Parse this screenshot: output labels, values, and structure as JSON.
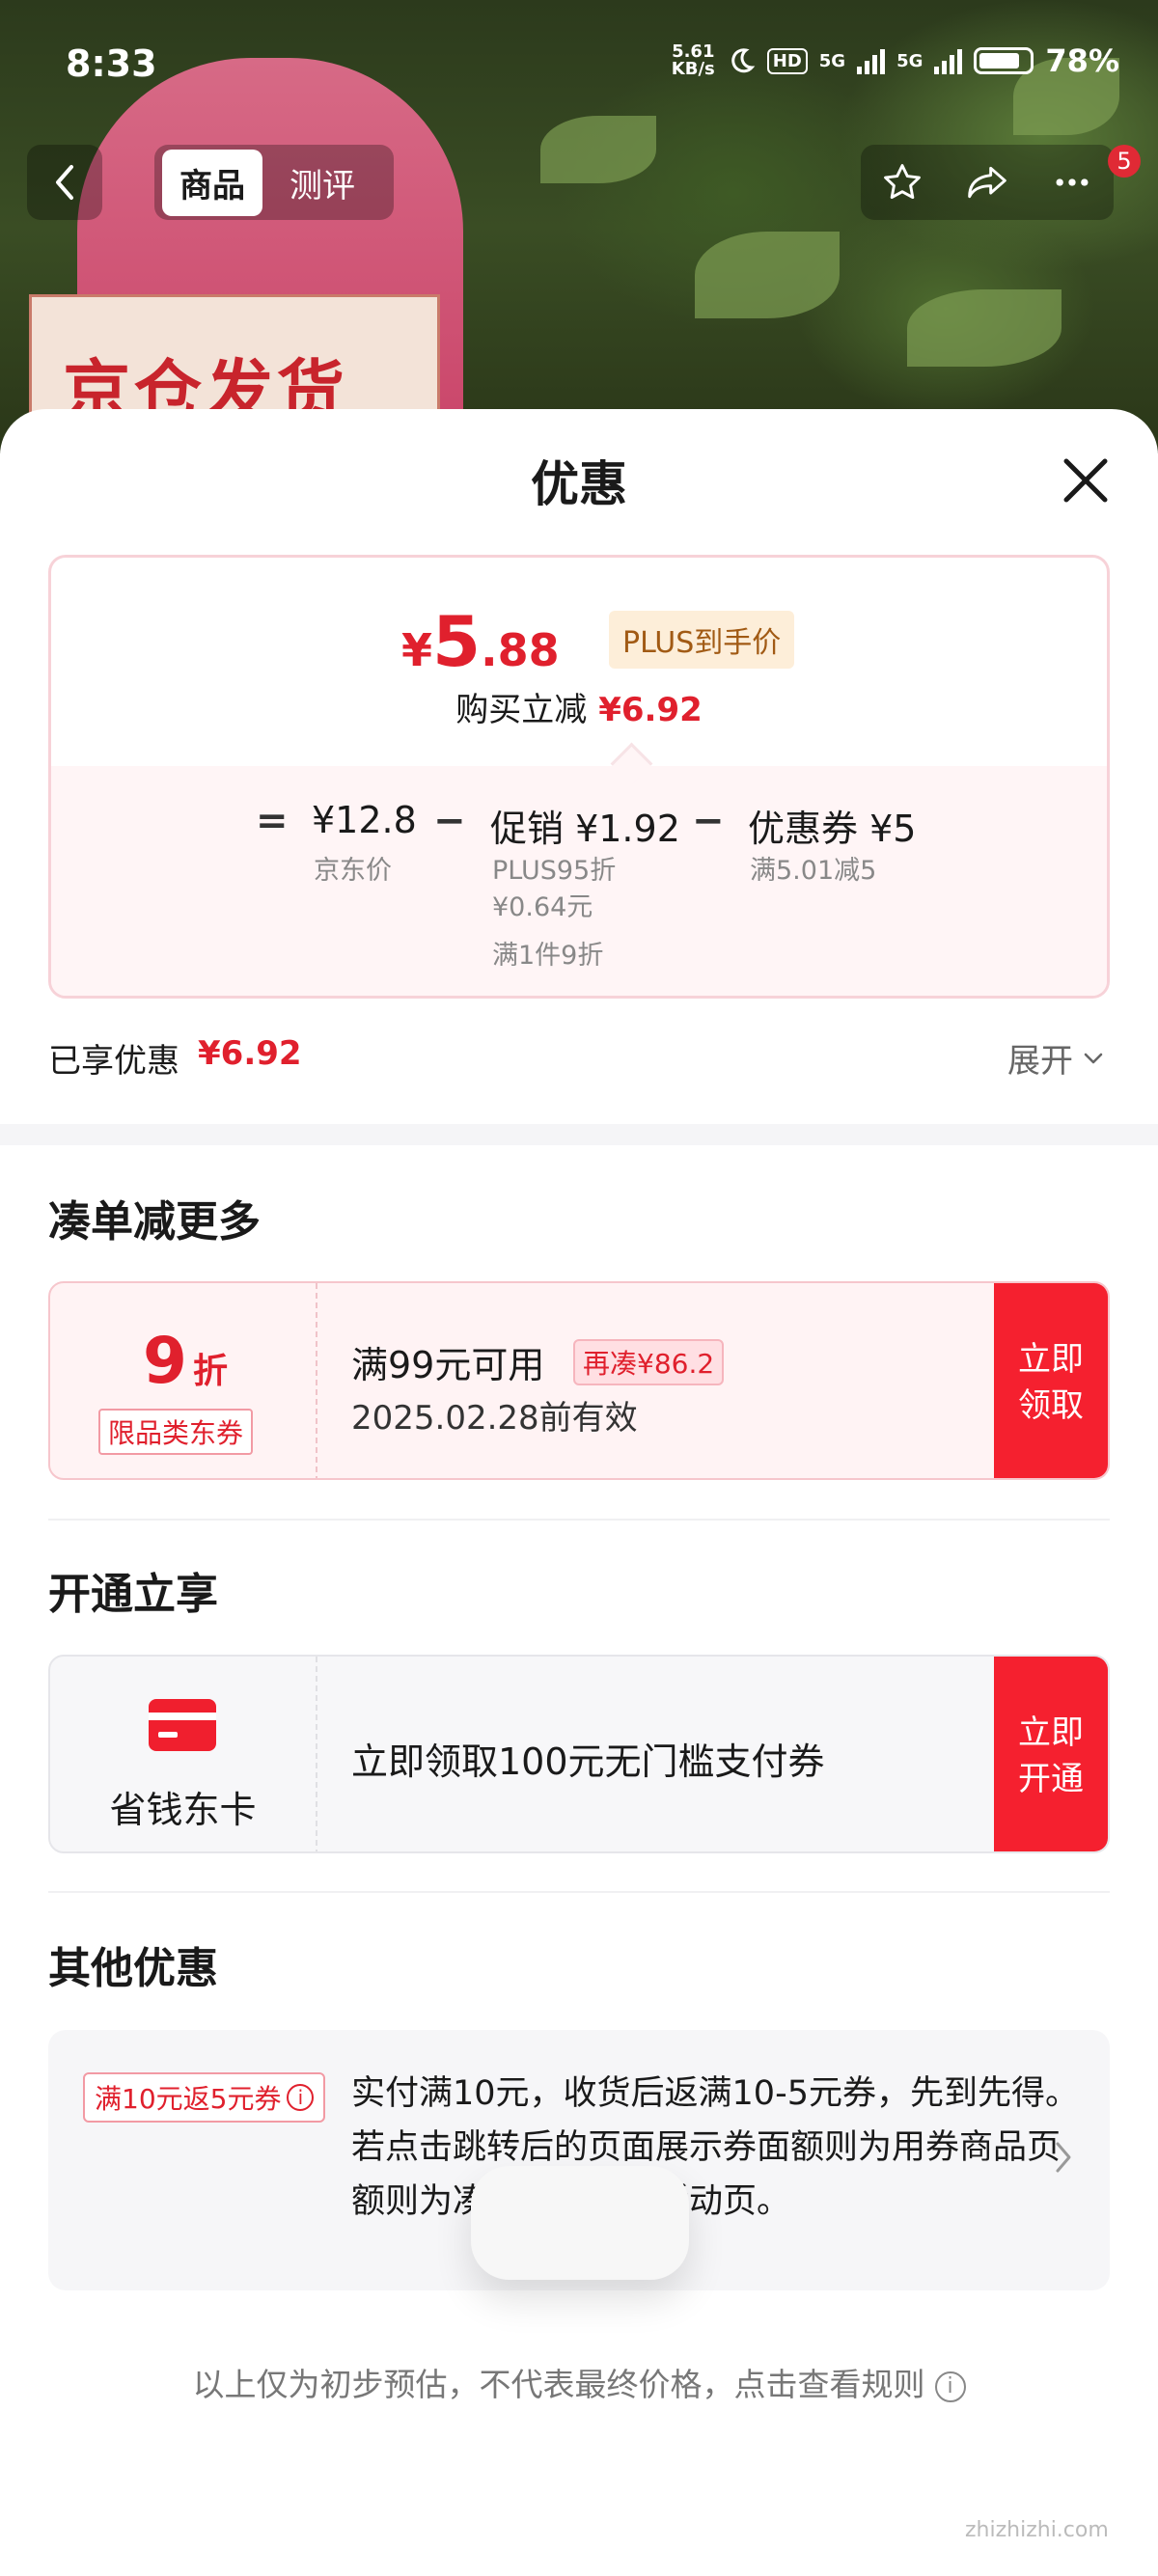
{
  "status_bar": {
    "time": "8:33",
    "net_speed_value": "5.61",
    "net_speed_unit": "KB/s",
    "hd_label": "HD",
    "signal1_label": "5G",
    "signal2_label": "5G",
    "battery": "78%"
  },
  "background": {
    "sign_text": "京仓发货"
  },
  "nav": {
    "back_icon": "chevron-left-icon",
    "tabs": [
      {
        "label": "商品",
        "active": true
      },
      {
        "label": "测评",
        "active": false
      }
    ],
    "notification_count": "5"
  },
  "sheet": {
    "title": "优惠",
    "price": {
      "yen": "¥",
      "int": "5",
      "dec": ".88",
      "plus_tag": "PLUS到手价",
      "buy_label": "购买立减",
      "buy_value": "¥6.92"
    },
    "breakdown": {
      "equals": "=",
      "minus": "−",
      "jd_price": "¥12.8",
      "jd_label": "京东价",
      "promo_label": "促销 ¥1.92",
      "promo_sub1": "PLUS95折",
      "promo_sub2": "¥0.64元",
      "promo_sub3": "满1件9折",
      "coupon_label": "优惠券 ¥5",
      "coupon_sub": "满5.01减5"
    },
    "enjoyed_label": "已享优惠",
    "enjoyed_value": "¥6.92",
    "expand_label": "展开"
  },
  "section_bundle": {
    "title": "凑单减更多",
    "coupon": {
      "discount_num": "9",
      "discount_unit": "折",
      "type_tag": "限品类东券",
      "condition": "满99元可用",
      "remaining_tag": "再凑¥86.2",
      "expiry": "2025.02.28前有效",
      "button_line1": "立即",
      "button_line2": "领取"
    }
  },
  "section_open": {
    "title": "开通立享",
    "card": {
      "name": "省钱东卡",
      "desc": "立即领取100元无门槛支付券",
      "button_line1": "立即",
      "button_line2": "开通"
    }
  },
  "section_other": {
    "title": "其他优惠",
    "rebate_tag": "满10元返5元券",
    "text": "实付满10元，收货后返满10-5元券，先到先得。若点击跳转后的页面展示券面额则为用券商品页              额则为凑单商品页或活动页。"
  },
  "footer_note": "以上仅为初步预估，不代表最终价格，点击查看规则",
  "watermark": "zhizhizhi.com",
  "colors": {
    "accent_red": "#e0202d",
    "button_red": "#f5202f",
    "plus_gold": "#a15a14"
  }
}
